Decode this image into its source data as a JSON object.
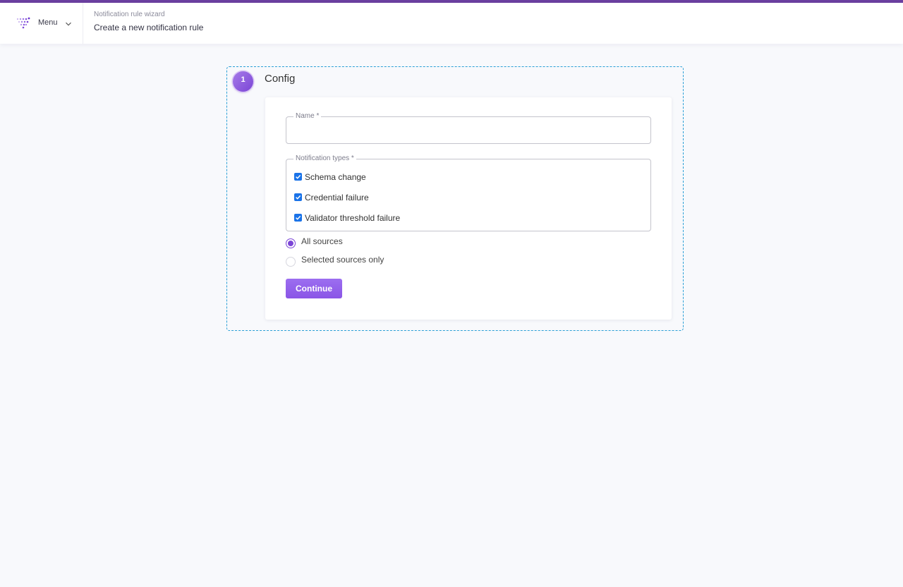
{
  "colors": {
    "accent_bar": "#6b3fa0",
    "step_frame": "#2a9fd6",
    "primary": "#8a55e6",
    "checkbox": "#1a73e8"
  },
  "header": {
    "menu_label": "Menu",
    "menu_icon": "chevron-down-icon",
    "logo_icon": "dots-logo-icon",
    "wizard_label": "Notification rule wizard",
    "page_title": "Create a new notification rule"
  },
  "step": {
    "number": "1",
    "title": "Config"
  },
  "form": {
    "name_label": "Name *",
    "name_value": "",
    "types_label": "Notification types *",
    "types": [
      {
        "label": "Schema change",
        "checked": true
      },
      {
        "label": "Credential failure",
        "checked": true
      },
      {
        "label": "Validator threshold failure",
        "checked": true
      }
    ],
    "sources": [
      {
        "label": "All sources",
        "selected": true
      },
      {
        "label": "Selected sources only",
        "selected": false
      }
    ],
    "continue_label": "Continue"
  }
}
